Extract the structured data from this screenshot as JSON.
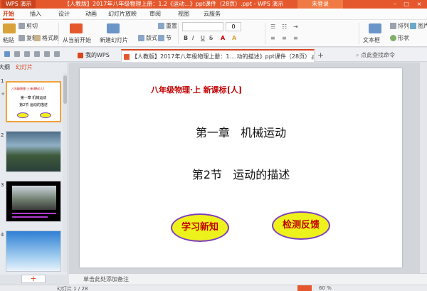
{
  "titlebar": {
    "app_name": "WPS 演示",
    "doc_title": "【人教版】2017年八年级物理上册：1.2《运动...》ppt课件（28页）.ppt - WPS 演示",
    "login": "未登录",
    "minimize": "–",
    "maximize": "□",
    "close": "×"
  },
  "menu": {
    "items": [
      "开始",
      "插入",
      "设计",
      "动画",
      "幻灯片放映",
      "审阅",
      "视图",
      "云服务"
    ]
  },
  "ribbon": {
    "paste": "粘贴",
    "cut": "剪切",
    "copy": "复制",
    "format_painter": "格式刷",
    "from_start": "从当前开始",
    "new_slide": "新建幻灯片",
    "layout": "版式",
    "reset": "重置",
    "section": "节",
    "font_size": "0",
    "text_box": "文本框",
    "shape": "形状",
    "arrange": "排列",
    "picture": "图片",
    "bold": "B",
    "italic": "I",
    "underline": "U",
    "strike": "S"
  },
  "tabs": {
    "home": "我的WPS",
    "doc": "【人教版】2017年八年级物理上册：1....动的描述》ppt课件（28页）.ppt",
    "search": "点此查找命令"
  },
  "leftpane": {
    "outline_tab": "大纲",
    "slides_tab": "幻灯片",
    "numbers": [
      "1",
      "2",
      "3",
      "4"
    ],
    "thumb1_header": "八年级物理·上   新课标[人]",
    "thumb1_chapter": "第一章  机械运动",
    "thumb1_section": "第2节  运动的描述",
    "add": "+"
  },
  "slide": {
    "header": "八年级物理·上      新课标[人]",
    "chapter": "第一章   机械运动",
    "section": "第2节   运动的描述",
    "button_learn": "学习新知",
    "button_test": "检测反馈"
  },
  "notes": {
    "placeholder": "单击此处添加备注"
  },
  "status": {
    "slide_info": "幻灯片 1 / 28",
    "zoom": "60 %"
  }
}
